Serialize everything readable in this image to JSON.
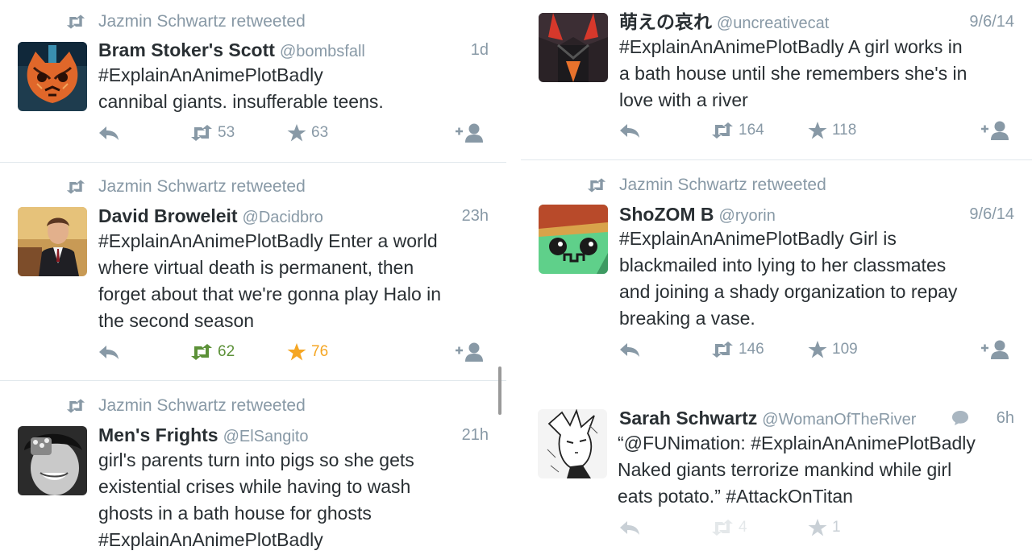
{
  "colors": {
    "meta": "#8899a6",
    "text": "#292f33",
    "retweeted": "#5c9138",
    "favorited": "#f5a623",
    "divider": "#e1e8ed"
  },
  "left_column": [
    {
      "retweeted_by": "Jazmin Schwartz retweeted",
      "name": "Bram Stoker's Scott",
      "handle": "@bombsfall",
      "time": "1d",
      "lines": [
        "#ExplainAnAnimePlotBadly",
        "cannibal giants. insufferable teens."
      ],
      "retweets": "53",
      "favorites": "63",
      "avatar": "orange-cat-mask-avatar"
    },
    {
      "retweeted_by": "Jazmin Schwartz retweeted",
      "name": "David Broweleit",
      "handle": "@Dacidbro",
      "time": "23h",
      "lines": [
        "#ExplainAnAnimePlotBadly Enter a world",
        "where virtual death is permanent, then",
        "forget about that we're gonna play Halo in",
        "the second season"
      ],
      "retweets": "62",
      "favorites": "76",
      "avatar": "man-in-suit-photo-avatar"
    },
    {
      "retweeted_by": "Jazmin Schwartz retweeted",
      "name": "Men's Frights",
      "handle": "@ElSangito",
      "time": "21h",
      "lines": [
        "girl's parents turn into pigs so she gets",
        "existential crises while having to wash",
        "ghosts in a bath house for ghosts",
        "#ExplainAnAnimePlotBadly"
      ],
      "avatar": "black-white-photo-avatar"
    }
  ],
  "right_column": [
    {
      "name": "萌えの哀れ",
      "handle": "@uncreativecat",
      "time": "9/6/14",
      "lines": [
        "#ExplainAnAnimePlotBadly A girl works in",
        "a bath house until she remembers she's in",
        "love with a river"
      ],
      "retweets": "164",
      "favorites": "118",
      "avatar": "anime-character-avatar"
    },
    {
      "retweeted_by": "Jazmin Schwartz retweeted",
      "name": "ShoZOM B",
      "handle": "@ryorin",
      "time": "9/6/14",
      "lines": [
        "#ExplainAnAnimePlotBadly Girl is",
        "blackmailed into lying to her classmates",
        "and joining a shady organization to repay",
        "breaking a vase."
      ],
      "retweets": "146",
      "favorites": "109",
      "avatar": "green-face-avatar"
    },
    {
      "name": "Sarah Schwartz",
      "handle": "@WomanOfTheRiver",
      "time": "6h",
      "lines": [
        "“@FUNimation: #ExplainAnAnimePlotBadly",
        "Naked giants terrorize mankind while girl",
        "eats potato.” #AttackOnTitan"
      ],
      "retweets": "4",
      "favorites": "1",
      "avatar": "manga-sketch-avatar"
    }
  ]
}
